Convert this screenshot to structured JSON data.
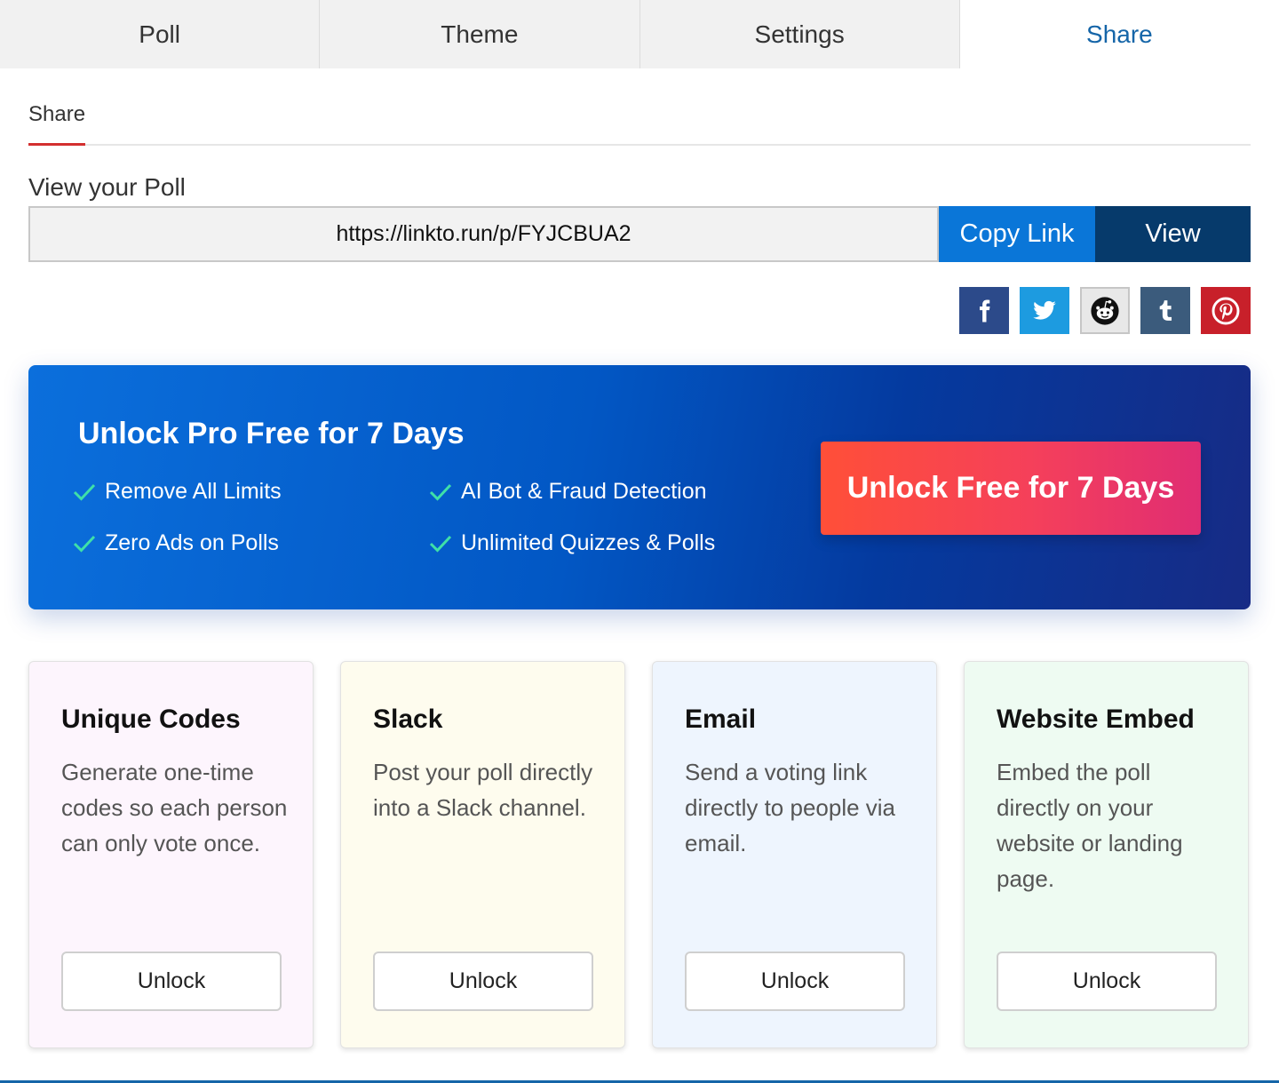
{
  "tabs": {
    "poll": "Poll",
    "theme": "Theme",
    "settings": "Settings",
    "share": "Share"
  },
  "subnav": {
    "share": "Share"
  },
  "view_poll": {
    "label": "View your Poll",
    "url": "https://linkto.run/p/FYJCBUA2",
    "copy_label": "Copy Link",
    "view_label": "View"
  },
  "social_icons": [
    "facebook-icon",
    "twitter-icon",
    "reddit-icon",
    "tumblr-icon",
    "pinterest-icon"
  ],
  "promo": {
    "title": "Unlock Pro Free for 7 Days",
    "features": [
      "Remove All Limits",
      "AI Bot & Fraud Detection",
      "Zero Ads on Polls",
      "Unlimited Quizzes & Polls"
    ],
    "button": "Unlock Free for 7 Days"
  },
  "cards": [
    {
      "title": "Unique Codes",
      "desc": "Generate one-time codes so each person can only vote once.",
      "button": "Unlock"
    },
    {
      "title": "Slack",
      "desc": "Post your poll directly into a Slack channel.",
      "button": "Unlock"
    },
    {
      "title": "Email",
      "desc": "Send a voting link directly to people via email.",
      "button": "Unlock"
    },
    {
      "title": "Website Embed",
      "desc": "Embed the poll directly on your website or landing page.",
      "button": "Unlock"
    }
  ],
  "colors": {
    "active_tab": "#1565a8",
    "copy_button": "#0a76d8",
    "view_button": "#063a6b",
    "subtab_underline": "#d32f2f",
    "check": "#3fe0a8",
    "promo_button": "#f5405a"
  }
}
